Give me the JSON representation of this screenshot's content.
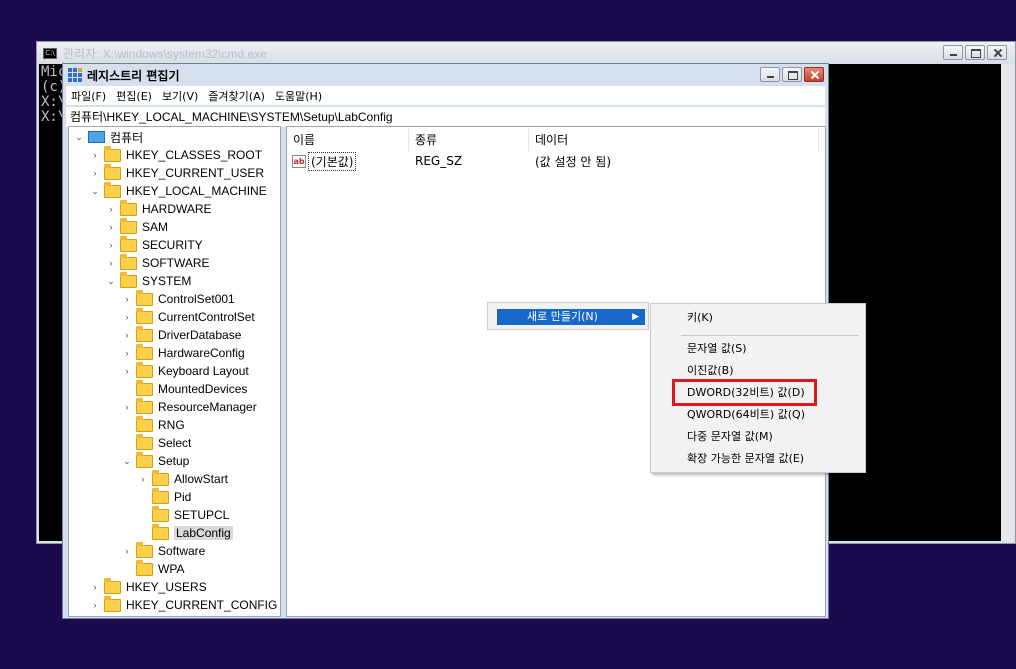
{
  "cmd": {
    "title": "관리자: X:\\windows\\system32\\cmd.exe",
    "lines": [
      "Mic",
      "(c)",
      "",
      "X:\\",
      "",
      "X:\\"
    ]
  },
  "regedit": {
    "title": "레지스트리 편집기",
    "menu": [
      "파일(F)",
      "편집(E)",
      "보기(V)",
      "즐겨찾기(A)",
      "도움말(H)"
    ],
    "address": "컴퓨터\\HKEY_LOCAL_MACHINE\\SYSTEM\\Setup\\LabConfig",
    "tree": [
      {
        "label": "컴퓨터",
        "level": 0,
        "expand": "open",
        "icon": "computer-icon"
      },
      {
        "label": "HKEY_CLASSES_ROOT",
        "level": 1,
        "expand": "closed"
      },
      {
        "label": "HKEY_CURRENT_USER",
        "level": 1,
        "expand": "closed"
      },
      {
        "label": "HKEY_LOCAL_MACHINE",
        "level": 1,
        "expand": "open"
      },
      {
        "label": "HARDWARE",
        "level": 2,
        "expand": "closed"
      },
      {
        "label": "SAM",
        "level": 2,
        "expand": "closed"
      },
      {
        "label": "SECURITY",
        "level": 2,
        "expand": "closed"
      },
      {
        "label": "SOFTWARE",
        "level": 2,
        "expand": "closed"
      },
      {
        "label": "SYSTEM",
        "level": 2,
        "expand": "open"
      },
      {
        "label": "ControlSet001",
        "level": 3,
        "expand": "closed"
      },
      {
        "label": "CurrentControlSet",
        "level": 3,
        "expand": "closed"
      },
      {
        "label": "DriverDatabase",
        "level": 3,
        "expand": "closed"
      },
      {
        "label": "HardwareConfig",
        "level": 3,
        "expand": "closed"
      },
      {
        "label": "Keyboard Layout",
        "level": 3,
        "expand": "closed"
      },
      {
        "label": "MountedDevices",
        "level": 3,
        "expand": "none"
      },
      {
        "label": "ResourceManager",
        "level": 3,
        "expand": "closed"
      },
      {
        "label": "RNG",
        "level": 3,
        "expand": "none"
      },
      {
        "label": "Select",
        "level": 3,
        "expand": "none"
      },
      {
        "label": "Setup",
        "level": 3,
        "expand": "open"
      },
      {
        "label": "AllowStart",
        "level": 4,
        "expand": "closed"
      },
      {
        "label": "Pid",
        "level": 4,
        "expand": "none"
      },
      {
        "label": "SETUPCL",
        "level": 4,
        "expand": "none"
      },
      {
        "label": "LabConfig",
        "level": 4,
        "expand": "none",
        "selected": true
      },
      {
        "label": "Software",
        "level": 3,
        "expand": "closed"
      },
      {
        "label": "WPA",
        "level": 3,
        "expand": "none"
      },
      {
        "label": "HKEY_USERS",
        "level": 1,
        "expand": "closed"
      },
      {
        "label": "HKEY_CURRENT_CONFIG",
        "level": 1,
        "expand": "closed"
      }
    ],
    "columns": [
      "이름",
      "종류",
      "데이터"
    ],
    "values": [
      {
        "name": "(기본값)",
        "type": "REG_SZ",
        "data": "(값 설정 안 됨)"
      }
    ]
  },
  "context_menu": {
    "new_label": "새로 만들기(N)",
    "items": [
      "키(K)",
      "문자열 값(S)",
      "이진값(B)",
      "DWORD(32비트) 값(D)",
      "QWORD(64비트) 값(Q)",
      "다중 문자열 값(M)",
      "확장 가능한 문자열 값(E)"
    ],
    "highlighted": "DWORD(32비트) 값(D)",
    "highlight_color": "#e0161d"
  },
  "colors": {
    "desktop": "#1b0b4e",
    "selection": "#1868c9"
  }
}
